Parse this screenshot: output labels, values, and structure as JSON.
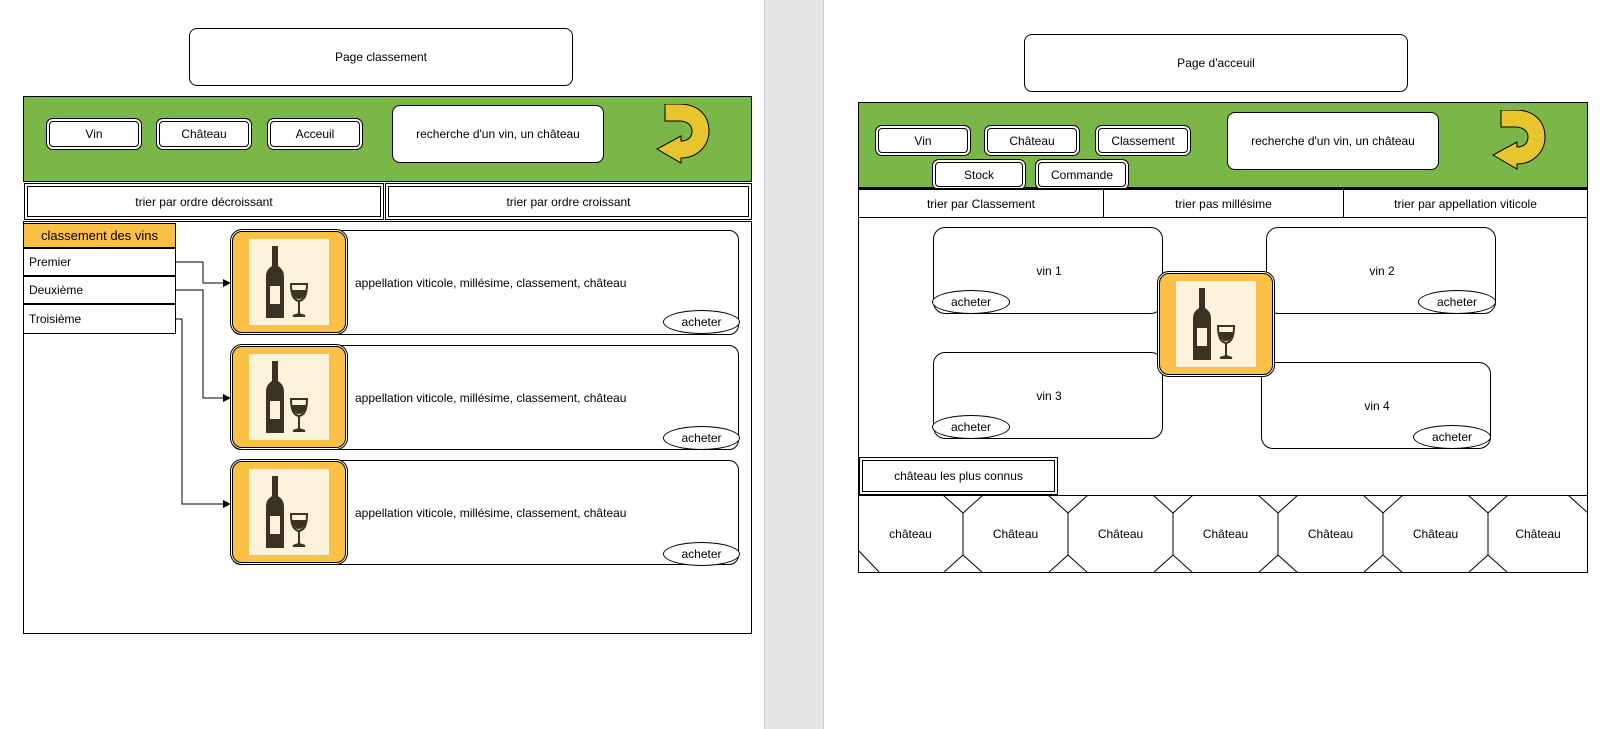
{
  "left_page": {
    "title": "Page classement",
    "nav": [
      "Vin",
      "Château",
      "Acceuil"
    ],
    "search": "recherche d'un vin, un château",
    "sort": [
      "trier par ordre décroissant",
      "trier par ordre croissant"
    ],
    "ranking": {
      "header": "classement des vins",
      "items": [
        "Premier",
        "Deuxième",
        "Troisième"
      ]
    },
    "cards": [
      {
        "text": "appellation viticole, millésime, classement, château",
        "button": "acheter"
      },
      {
        "text": "appellation viticole, millésime, classement, château",
        "button": "acheter"
      },
      {
        "text": "appellation viticole, millésime, classement, château",
        "button": "acheter"
      }
    ]
  },
  "right_page": {
    "title": "Page d'acceuil",
    "nav": [
      "Vin",
      "Château",
      "Classement",
      "Stock",
      "Commande"
    ],
    "search": "recherche d'un vin, un château",
    "sort": [
      "trier par Classement",
      "trier pas millésime",
      "trier par appellation viticole"
    ],
    "tiles": [
      {
        "label": "vin 1",
        "button": "acheter"
      },
      {
        "label": "vin 2",
        "button": "acheter"
      },
      {
        "label": "vin 3",
        "button": "acheter"
      },
      {
        "label": "vin 4",
        "button": "acheter"
      }
    ],
    "chateaux_header": "château les plus connus",
    "chateaux": [
      "château",
      "Château",
      "Château",
      "Château",
      "Château",
      "Château",
      "Château"
    ]
  },
  "colors": {
    "green": "#7ab648",
    "orange": "#fbc146",
    "arrow": "#e6c52e",
    "bottle": "#3a3324",
    "gutter": "#e6e6e6"
  },
  "icons": {
    "back": "back-arrow-icon",
    "wine": "wine-bottle-glass-icon"
  }
}
